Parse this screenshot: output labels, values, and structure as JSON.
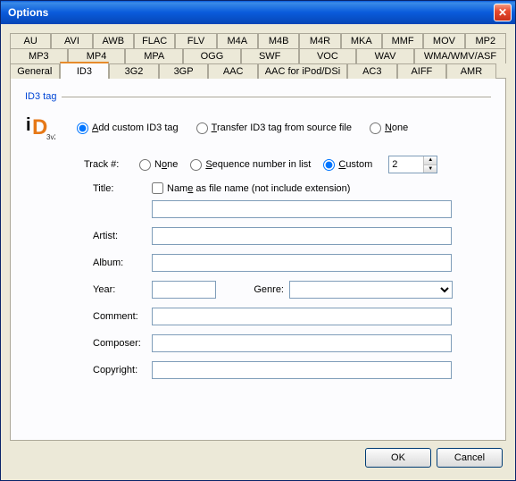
{
  "window": {
    "title": "Options"
  },
  "tabs": {
    "row1": [
      "AU",
      "AVI",
      "AWB",
      "FLAC",
      "FLV",
      "M4A",
      "M4B",
      "M4R",
      "MKA",
      "MMF",
      "MOV",
      "MP2"
    ],
    "row2": [
      "MP3",
      "MP4",
      "MPA",
      "OGG",
      "SWF",
      "VOC",
      "WAV"
    ],
    "row2_wide": "WMA/WMV/ASF",
    "row3": [
      "General",
      "ID3",
      "3G2",
      "3GP",
      "AAC"
    ],
    "row3_wide": "AAC for iPod/DSi",
    "row3b": [
      "AC3",
      "AIFF",
      "AMR"
    ],
    "active": "ID3"
  },
  "group": {
    "title": "ID3 tag"
  },
  "radios_main": {
    "add": "Add custom ID3 tag",
    "transfer": "Transfer ID3 tag from source file",
    "none": "None",
    "selected": "add"
  },
  "track": {
    "label": "Track #:",
    "none": "None",
    "seq": "Sequence number in list",
    "custom": "Custom",
    "selected": "custom",
    "value": "2"
  },
  "title_row": {
    "label": "Title:",
    "checkbox": "Name as file name (not include extension)",
    "checked": false,
    "value": ""
  },
  "fields": {
    "artist": {
      "label": "Artist:",
      "value": ""
    },
    "album": {
      "label": "Album:",
      "value": ""
    },
    "year": {
      "label": "Year:",
      "value": ""
    },
    "genre": {
      "label": "Genre:",
      "value": ""
    },
    "comment": {
      "label": "Comment:",
      "value": ""
    },
    "composer": {
      "label": "Composer:",
      "value": ""
    },
    "copyright": {
      "label": "Copyright:",
      "value": ""
    }
  },
  "buttons": {
    "ok": "OK",
    "cancel": "Cancel"
  }
}
